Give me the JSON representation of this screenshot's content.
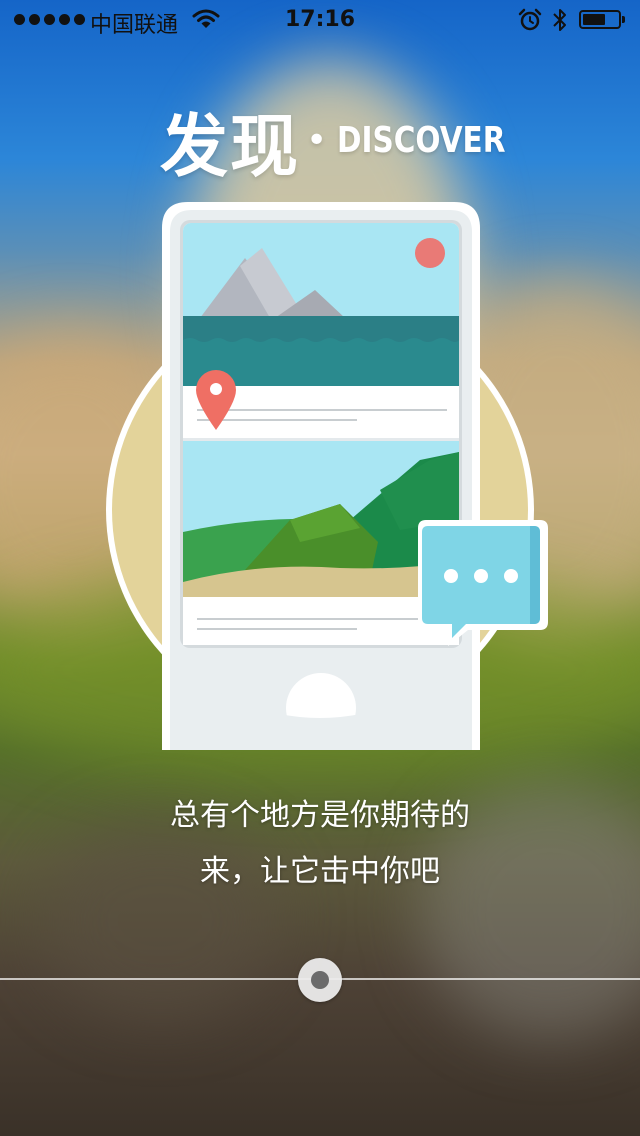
{
  "status_bar": {
    "carrier": "中国联通",
    "time": "17:16",
    "icons": [
      "signal-dots-icon",
      "wifi-icon",
      "alarm-clock-icon",
      "bluetooth-icon",
      "battery-icon"
    ],
    "battery_level": 0.55
  },
  "hero": {
    "title_cn": "发现",
    "separator": "•",
    "title_en": "DISCOVER"
  },
  "illustration": {
    "icons": [
      "phone-illustration",
      "mountain-lake-card",
      "map-pin-icon",
      "green-hills-card",
      "chat-bubble-icon"
    ],
    "colors": {
      "circle": "#e3d39a",
      "sky": "#a9e6f3",
      "sea": "#2a8a8e",
      "pin": "#ef6f64",
      "bubble": "#7fd5e6"
    }
  },
  "caption": {
    "line1": "总有个地方是你期待的",
    "line2": "来，让它击中你吧"
  },
  "pager": {
    "total": 1,
    "current": 1
  }
}
